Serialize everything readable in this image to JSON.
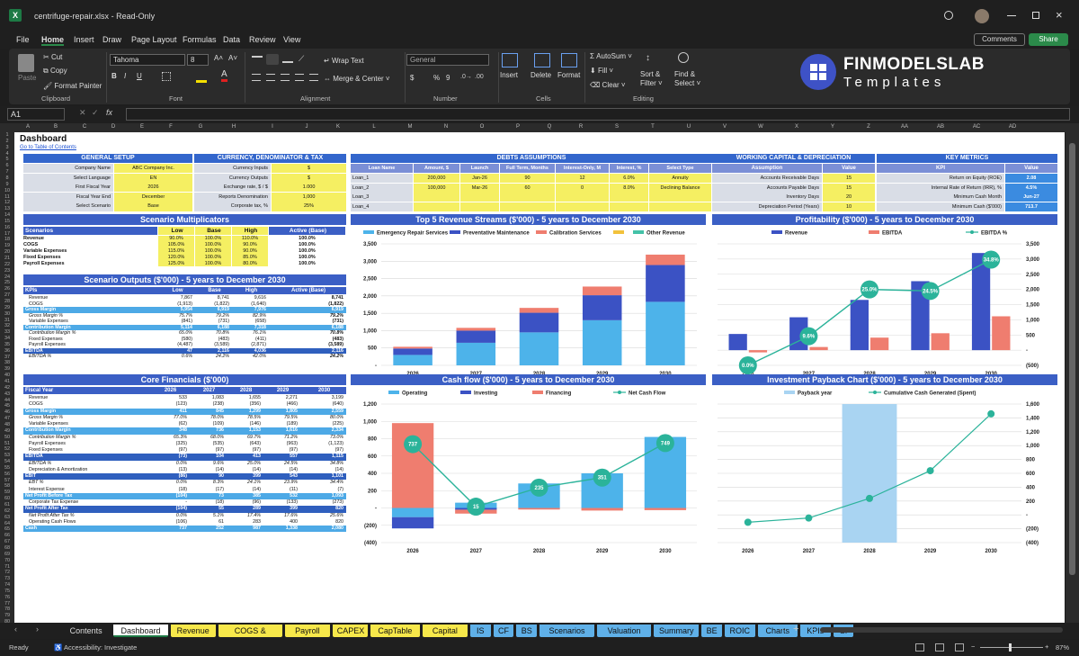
{
  "window": {
    "filename": "centrifuge-repair.xlsx",
    "separator": "-",
    "mode": "Read-Only"
  },
  "menu": [
    "File",
    "Home",
    "Insert",
    "Draw",
    "Page Layout",
    "Formulas",
    "Data",
    "Review",
    "View"
  ],
  "menu_active": "Home",
  "comments": "Comments",
  "share": "Share",
  "ribbon": {
    "paste": "Paste",
    "cut": "Cut",
    "copy": "Copy",
    "format_painter": "Format Painter",
    "clipboard": "Clipboard",
    "font_name": "Tahoma",
    "font_size": "8",
    "font_group": "Font",
    "bold": "B",
    "italic": "I",
    "underline": "U",
    "wrap": "Wrap Text",
    "merge": "Merge & Center",
    "alignment": "Alignment",
    "number_format": "General",
    "number": "Number",
    "currency": "$",
    "percent": "%",
    "comma": "9",
    "insert": "Insert",
    "delete": "Delete",
    "format": "Format",
    "cells": "Cells",
    "autosum": "AutoSum",
    "fill": "Fill",
    "clear": "Clear",
    "sort": "Sort &",
    "filter": "Filter",
    "find": "Find &",
    "select": "Select",
    "editing": "Editing",
    "logo_main": "FINMODELSLAB",
    "logo_sub": "Templates"
  },
  "namebox": "A1",
  "fx": "fx",
  "columns": [
    "A",
    "B",
    "C",
    "D",
    "E",
    "F",
    "G",
    "H",
    "I",
    "J",
    "K",
    "L",
    "M",
    "N",
    "O",
    "P",
    "Q",
    "R",
    "S",
    "T",
    "U",
    "V",
    "W",
    "X",
    "Y",
    "Z",
    "AA",
    "AB",
    "AC",
    "AD"
  ],
  "sheet": {
    "title": "Dashboard",
    "toc": "Go to Table of Contents",
    "general": {
      "header": "GENERAL SETUP",
      "rows": [
        [
          "Company Name",
          "ABC Company Inc."
        ],
        [
          "Select Language",
          "EN"
        ],
        [
          "First Fiscal Year",
          "2026"
        ],
        [
          "Fiscal Year End",
          "December"
        ],
        [
          "Select Scenario",
          "Base"
        ]
      ]
    },
    "currency": {
      "header": "CURRENCY, DENOMINATOR & TAX",
      "rows": [
        [
          "Currency Inputs",
          "$"
        ],
        [
          "Currency Outputs",
          "$"
        ],
        [
          "Exchange rate, $ / $",
          "1.000"
        ],
        [
          "Reports Denomination",
          "1,000"
        ],
        [
          "Corporate tax, %",
          "25%"
        ]
      ]
    },
    "debts": {
      "header": "DEBTS ASSUMPTIONS",
      "cols": [
        "Loan Name",
        "Amount, $",
        "Launch",
        "Full Term, Months",
        "Interest-Only, M",
        "Interest, %",
        "Select Type"
      ],
      "rows": [
        [
          "Loan_1",
          "200,000",
          "Jan-26",
          "90",
          "12",
          "6.0%",
          "Annuity"
        ],
        [
          "Loan_2",
          "100,000",
          "Mar-26",
          "60",
          "0",
          "8.0%",
          "Declining Balance"
        ],
        [
          "Loan_3",
          "",
          "",
          "",
          "",
          "",
          ""
        ],
        [
          "Loan_4",
          "",
          "",
          "",
          "",
          "",
          ""
        ]
      ]
    },
    "wc": {
      "header": "WORKING CAPITAL & DEPRECIATION",
      "cols": [
        "Assumption",
        "Value"
      ],
      "rows": [
        [
          "Accounts Receivable Days",
          "15"
        ],
        [
          "Accounts Payable Days",
          "15"
        ],
        [
          "Inventory Days",
          "20"
        ],
        [
          "Depreciation Period (Years)",
          "10"
        ]
      ]
    },
    "kpi": {
      "header": "KEY METRICS",
      "cols": [
        "KPI",
        "Value"
      ],
      "rows": [
        [
          "Return on Equity (ROE)",
          "2.08"
        ],
        [
          "Internal Rate of Return (IRR), %",
          "4.5%"
        ],
        [
          "Minimum Cash Month",
          "Jun-27"
        ],
        [
          "Minimum Cash ($'000)",
          "713.7"
        ]
      ]
    },
    "multipliers": {
      "title": "Scenario Multiplicators",
      "cols": [
        "Scenarios",
        "Low",
        "Base",
        "High",
        "Active (Base)"
      ],
      "rows": [
        [
          "Revenue",
          "90.0%",
          "100.0%",
          "110.0%",
          "100.0%"
        ],
        [
          "COGS",
          "105.0%",
          "100.0%",
          "90.0%",
          "100.0%"
        ],
        [
          "Variable Expenses",
          "115.0%",
          "100.0%",
          "90.0%",
          "100.0%"
        ],
        [
          "Fixed Expenses",
          "120.0%",
          "100.0%",
          "85.0%",
          "100.0%"
        ],
        [
          "Payroll Expenses",
          "125.0%",
          "100.0%",
          "80.0%",
          "100.0%"
        ]
      ]
    },
    "outputs": {
      "title": "Scenario Outputs ($'000) - 5 years to December 2030",
      "cols": [
        "KPIs",
        "Low",
        "Base",
        "High",
        "Active (Base)"
      ],
      "rows": [
        [
          "Revenue",
          "7,867",
          "8,741",
          "9,616",
          "8,741",
          ""
        ],
        [
          "COGS",
          "(1,913)",
          "(1,822)",
          "(1,640)",
          "(1,822)",
          ""
        ],
        [
          "Gross Margin",
          "5,954",
          "6,919",
          "7,976",
          "6,919",
          "hl"
        ],
        [
          "Gross Margin %",
          "75.7%",
          "79.2%",
          "82.9%",
          "79.2%",
          "it"
        ],
        [
          "Variable Expenses",
          "(841)",
          "(731)",
          "(658)",
          "(731)",
          ""
        ],
        [
          "Contribution Margin",
          "5,114",
          "6,188",
          "7,318",
          "6,188",
          "hl"
        ],
        [
          "Contribution Margin %",
          "65.0%",
          "70.8%",
          "76.1%",
          "70.8%",
          "it"
        ],
        [
          "Fixed Expenses",
          "(580)",
          "(483)",
          "(411)",
          "(483)",
          ""
        ],
        [
          "Payroll Expenses",
          "(4,487)",
          "(3,589)",
          "(2,871)",
          "(3,589)",
          ""
        ],
        [
          "EBITDA",
          "47",
          "2,116",
          "4,036",
          "2,116",
          "dk"
        ],
        [
          "EBITDA %",
          "0.6%",
          "24.2%",
          "42.0%",
          "24.2%",
          "it"
        ]
      ]
    },
    "core": {
      "title": "Core Financials ($'000)",
      "cols": [
        "Fiscal Year",
        "2026",
        "2027",
        "2028",
        "2029",
        "2030"
      ],
      "rows": [
        [
          "Revenue",
          "533",
          "1,083",
          "1,655",
          "2,271",
          "3,199",
          ""
        ],
        [
          "COGS",
          "(123)",
          "(238)",
          "(356)",
          "(466)",
          "(640)",
          ""
        ],
        [
          "Gross Margin",
          "411",
          "845",
          "1,299",
          "1,805",
          "2,559",
          "hl"
        ],
        [
          "Gross Margin %",
          "77.0%",
          "78.0%",
          "78.5%",
          "79.5%",
          "80.0%",
          "it"
        ],
        [
          "Variable Expenses",
          "(62)",
          "(109)",
          "(146)",
          "(189)",
          "(225)",
          ""
        ],
        [
          "Contribution Margin",
          "348",
          "736",
          "1,153",
          "1,616",
          "2,334",
          "hl"
        ],
        [
          "Contribution Margin %",
          "65.3%",
          "68.0%",
          "69.7%",
          "71.2%",
          "73.0%",
          "it"
        ],
        [
          "Payroll Expenses",
          "(325)",
          "(535)",
          "(643)",
          "(963)",
          "(1,123)",
          ""
        ],
        [
          "Fixed Expenses",
          "(97)",
          "(97)",
          "(97)",
          "(97)",
          "(97)",
          ""
        ],
        [
          "EBITDA",
          "(73)",
          "104",
          "413",
          "557",
          "1,115",
          "dk"
        ],
        [
          "EBITDA %",
          "0.0%",
          "9.6%",
          "25.0%",
          "24.5%",
          "34.8%",
          "it"
        ],
        [
          "Depreciation & Amortization",
          "(13)",
          "(14)",
          "(14)",
          "(14)",
          "(14)",
          ""
        ],
        [
          "EBIT",
          "(86)",
          "90",
          "399",
          "543",
          "1,101",
          "dk"
        ],
        [
          "EBT %",
          "0.0%",
          "8.3%",
          "24.1%",
          "23.9%",
          "34.4%",
          "it"
        ],
        [
          "Interest Expense",
          "(18)",
          "(17)",
          "(14)",
          "(11)",
          "(7)",
          ""
        ],
        [
          "Net Profit Before Tax",
          "(104)",
          "73",
          "385",
          "532",
          "1,093",
          "hl"
        ],
        [
          "Corporate Tax Expense",
          "-",
          "(18)",
          "(96)",
          "(133)",
          "(273)",
          ""
        ],
        [
          "Net Profit After Tax",
          "(104)",
          "55",
          "289",
          "399",
          "820",
          "dk"
        ],
        [
          "Net Profit After Tax %",
          "0.0%",
          "5.1%",
          "17.4%",
          "17.6%",
          "25.6%",
          "it"
        ],
        [
          "Operating Cash Flows",
          "(106)",
          "61",
          "283",
          "400",
          "820",
          ""
        ],
        [
          "Cash",
          "737",
          "252",
          "987",
          "1,338",
          "2,080",
          "hl"
        ]
      ]
    }
  },
  "chart_data": [
    {
      "type": "bar",
      "title": "Top 5 Revenue Streams ($'000) - 5 years to December 2030",
      "categories": [
        "2026",
        "2027",
        "2028",
        "2029",
        "2030"
      ],
      "series": [
        {
          "name": "Emergency Repair Services",
          "color": "#4db3ea",
          "values": [
            300,
            650,
            950,
            1300,
            1830
          ]
        },
        {
          "name": "Preventative Maintenance",
          "color": "#3b52c4",
          "values": [
            185,
            350,
            565,
            720,
            1060
          ]
        },
        {
          "name": "Calibration Services",
          "color": "#ef7d6f",
          "values": [
            50,
            80,
            140,
            250,
            300
          ]
        },
        {
          "name": "",
          "color": "#f2c23c",
          "values": [
            0,
            0,
            0,
            0,
            0
          ]
        },
        {
          "name": "Other Revenue",
          "color": "#44c2a8",
          "values": [
            0,
            0,
            0,
            0,
            0
          ]
        }
      ],
      "ylim": [
        0,
        3500
      ],
      "yticks": [
        "-",
        "500",
        "1,000",
        "1,500",
        "2,000",
        "2,500",
        "3,000",
        "3,500"
      ],
      "grid": true,
      "legend": "top"
    },
    {
      "type": "bar",
      "title": "Profitability ($'000) - 5 years to December 2030",
      "categories": [
        "2026",
        "2027",
        "2028",
        "2029",
        "2030"
      ],
      "series": [
        {
          "name": "Revenue",
          "color": "#3b52c4",
          "values": [
            533,
            1083,
            1655,
            2271,
            3199
          ]
        },
        {
          "name": "EBITDA",
          "color": "#ef7d6f",
          "values": [
            -73,
            104,
            413,
            557,
            1115
          ]
        },
        {
          "name": "EBITDA %",
          "color": "#2bb39a",
          "values": [
            0.0,
            9.6,
            25.0,
            24.5,
            34.8
          ],
          "labels": [
            "0.0%",
            "9.6%",
            "25.0%",
            "24.5%",
            "34.8%"
          ]
        }
      ],
      "ylim": [
        -500,
        3500
      ],
      "yticks": [
        "(500)",
        "-",
        "500",
        "1,000",
        "1,500",
        "2,000",
        "2,500",
        "3,000",
        "3,500"
      ],
      "grid": true,
      "legend": "top"
    },
    {
      "type": "bar",
      "title": "Cash flow ($'000) - 5 years to December 2030",
      "categories": [
        "2026",
        "2027",
        "2028",
        "2029",
        "2030"
      ],
      "series": [
        {
          "name": "Operating",
          "color": "#4db3ea",
          "values": [
            -106,
            61,
            283,
            400,
            820
          ]
        },
        {
          "name": "Investing",
          "color": "#3b52c4",
          "values": [
            -130,
            -20,
            0,
            0,
            0
          ]
        },
        {
          "name": "Financing",
          "color": "#ef7d6f",
          "values": [
            980,
            -45,
            -18,
            -30,
            -25
          ]
        },
        {
          "name": "Net Cash Flow",
          "color": "#2bb39a",
          "values": [
            737,
            15,
            235,
            351,
            749
          ],
          "labels": [
            "737",
            "15",
            "235",
            "351",
            "749"
          ]
        }
      ],
      "ylim": [
        -400,
        1200
      ],
      "yticks": [
        "(400)",
        "(200)",
        "-",
        "200",
        "400",
        "600",
        "800",
        "1,000",
        "1,200"
      ],
      "grid": true,
      "legend": "top"
    },
    {
      "type": "line",
      "title": "Investment Payback Chart ($'000) - 5 years to December 2030",
      "categories": [
        "2026",
        "2027",
        "2028",
        "2029",
        "2030"
      ],
      "series": [
        {
          "name": "Payback year",
          "color": "#a9d4f2",
          "values": [
            0,
            0,
            1,
            0,
            0
          ]
        },
        {
          "name": "Cumulative Cash Generated (Spent)",
          "color": "#2bb39a",
          "values": [
            -106,
            -45,
            238,
            638,
            1458
          ]
        }
      ],
      "ylim": [
        -400,
        1600
      ],
      "yticks": [
        "(400)",
        "(200)",
        "-",
        "200",
        "400",
        "600",
        "800",
        "1,000",
        "1,200",
        "1,400",
        "1,600"
      ],
      "grid": true,
      "legend": "top"
    }
  ],
  "tabs": [
    [
      "Contents",
      ""
    ],
    [
      "Dashboard",
      "active"
    ],
    [
      "Revenue",
      "y"
    ],
    [
      "COGS & OPEX",
      "y"
    ],
    [
      "Payroll",
      "y"
    ],
    [
      "CAPEX",
      "y"
    ],
    [
      "CapTable",
      "y"
    ],
    [
      "Capital",
      "y"
    ],
    [
      "IS",
      "b"
    ],
    [
      "CF",
      "b"
    ],
    [
      "BS",
      "b"
    ],
    [
      "Scenarios",
      "b"
    ],
    [
      "Valuation",
      "b"
    ],
    [
      "Summary",
      "b"
    ],
    [
      "BE",
      "b"
    ],
    [
      "ROIC",
      "b"
    ],
    [
      "Charts",
      "b"
    ],
    [
      "KPIs",
      "b"
    ],
    [
      "Si",
      "b"
    ]
  ],
  "status": {
    "ready": "Ready",
    "accessibility": "Accessibility: Investigate",
    "zoom": "87%"
  }
}
